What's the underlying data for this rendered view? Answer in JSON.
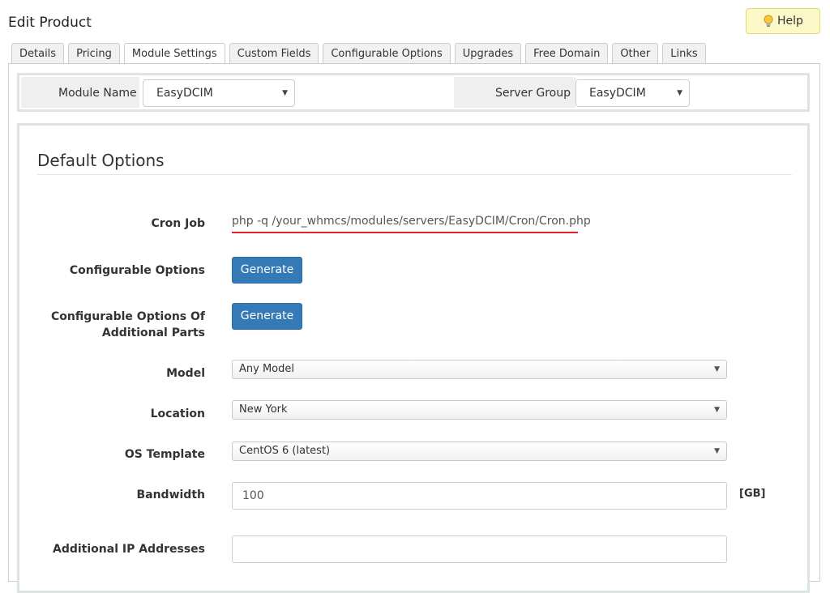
{
  "page_title": "Edit Product",
  "help_label": "Help",
  "tabs": [
    "Details",
    "Pricing",
    "Module Settings",
    "Custom Fields",
    "Configurable Options",
    "Upgrades",
    "Free Domain",
    "Other",
    "Links"
  ],
  "active_tab": "Module Settings",
  "module": {
    "name_label": "Module Name",
    "name_value": "EasyDCIM",
    "server_group_label": "Server Group",
    "server_group_value": "EasyDCIM"
  },
  "section_title": "Default Options",
  "fields": {
    "cron_label": "Cron Job",
    "cron_value": "php -q /your_whmcs/modules/servers/EasyDCIM/Cron/Cron.php",
    "config_options_label": "Configurable Options",
    "config_options_button": "Generate",
    "config_additional_label_line1": "Configurable Options Of",
    "config_additional_label_line2": "Additional Parts",
    "config_additional_button": "Generate",
    "model_label": "Model",
    "model_value": "Any Model",
    "location_label": "Location",
    "location_value": "New York",
    "os_label": "OS Template",
    "os_value": "CentOS 6 (latest)",
    "bandwidth_label": "Bandwidth",
    "bandwidth_value": "100",
    "bandwidth_unit": "[GB]",
    "additional_ip_label": "Additional IP Addresses",
    "additional_ip_value": ""
  },
  "colors": {
    "primary_button": "#337ab7",
    "cron_underline": "#e0202a",
    "help_bg": "#fcf8c7"
  }
}
